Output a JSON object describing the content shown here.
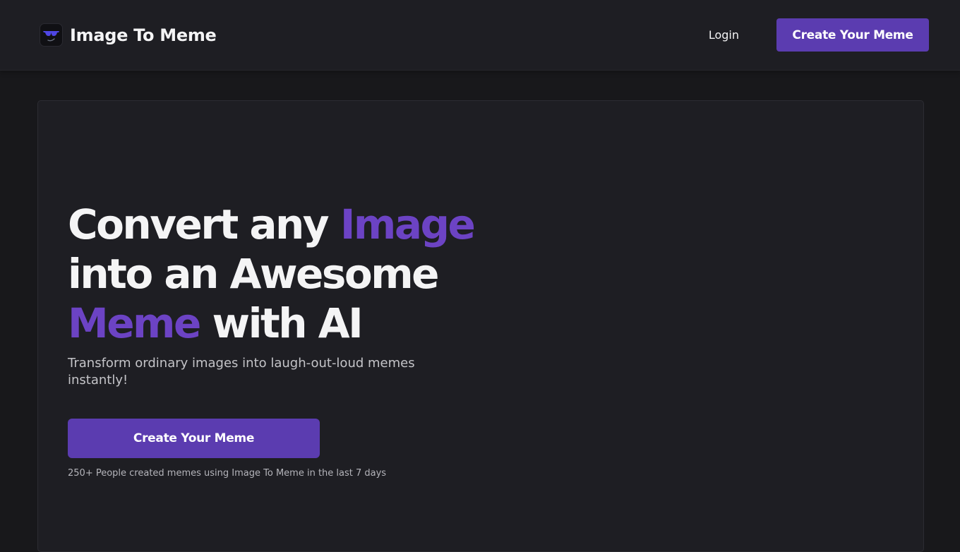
{
  "brand": {
    "name": "Image To Meme",
    "logo_icon": "sunglasses-face-icon"
  },
  "nav": {
    "login_label": "Login",
    "cta_label": "Create Your Meme"
  },
  "hero": {
    "title_line1_plain": "Convert any ",
    "title_line1_accent": "Image",
    "title_line2": "into an Awesome",
    "title_line3_accent": "Meme",
    "title_line3_plain": " with AI",
    "subtitle": "Transform ordinary images into laugh-out-loud memes instantly!",
    "cta_label": "Create Your Meme",
    "social_proof": "250+ People created memes using Image To Meme in the last 7 days"
  },
  "colors": {
    "accent": "#6c43c4",
    "button": "#5b3cb0",
    "background": "#18181b",
    "surface": "#1e1e23"
  }
}
